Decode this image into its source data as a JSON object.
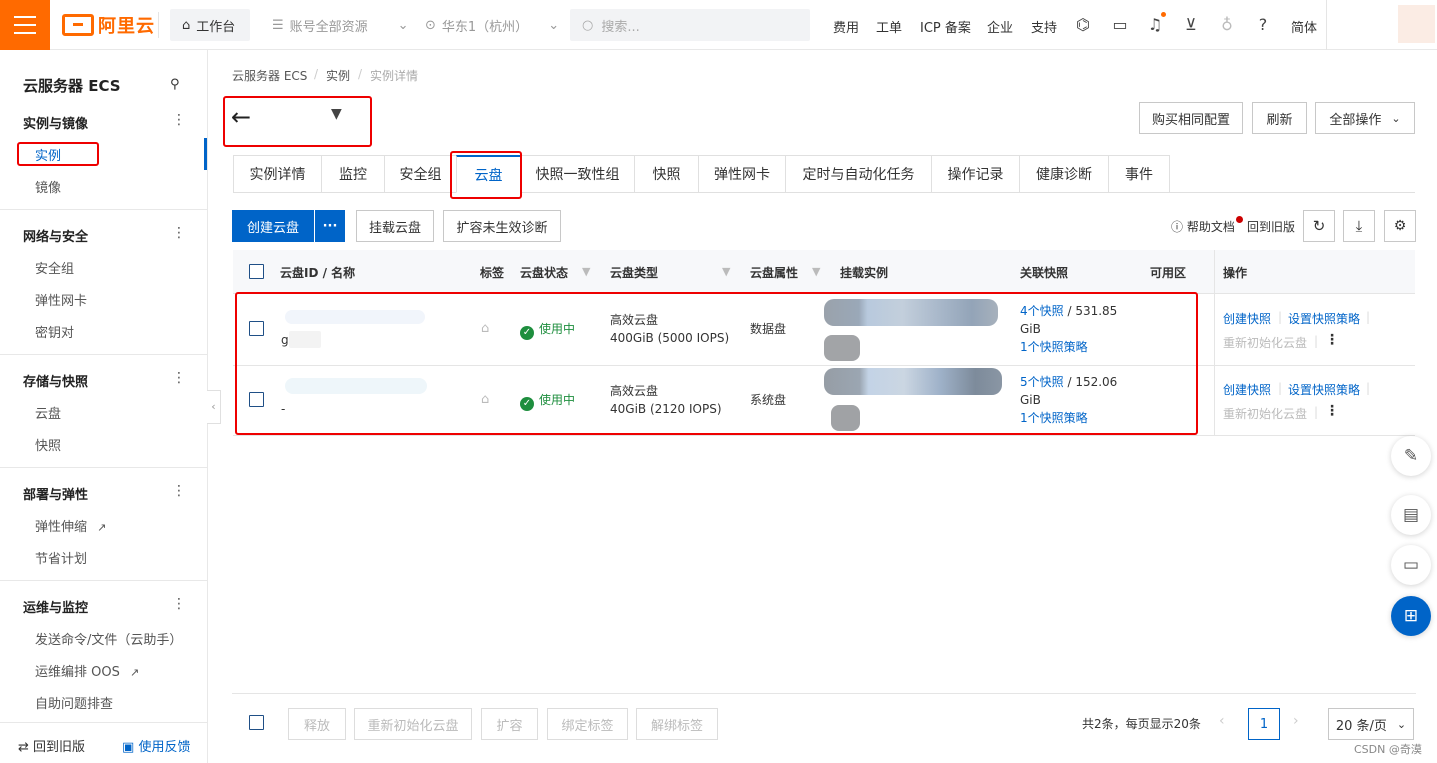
{
  "topbar": {
    "logo_text": "阿里云",
    "workbench": "工作台",
    "account_scope": "账号全部资源",
    "region": "华东1（杭州）",
    "search_placeholder": "搜索...",
    "links": [
      "费用",
      "工单",
      "ICP 备案",
      "企业",
      "支持"
    ],
    "language": "简体",
    "brand_color": "#ff6a00"
  },
  "sidebar": {
    "title": "云服务器 ECS",
    "groups": [
      {
        "title": "实例与镜像",
        "items": [
          "实例",
          "镜像"
        ]
      },
      {
        "title": "网络与安全",
        "items": [
          "安全组",
          "弹性网卡",
          "密钥对"
        ]
      },
      {
        "title": "存储与快照",
        "items": [
          "云盘",
          "快照"
        ]
      },
      {
        "title": "部署与弹性",
        "items": [
          "弹性伸缩",
          "节省计划"
        ]
      },
      {
        "title": "运维与监控",
        "items": [
          "发送命令/文件（云助手）",
          "运维编排 OOS",
          "自助问题排查"
        ]
      }
    ],
    "back_old": "回到旧版",
    "feedback": "使用反馈"
  },
  "breadcrumb": [
    "云服务器 ECS",
    "实例",
    "实例详情"
  ],
  "header_buttons": {
    "buy_same": "购买相同配置",
    "refresh": "刷新",
    "all_ops": "全部操作"
  },
  "tabs": [
    "实例详情",
    "监控",
    "安全组",
    "云盘",
    "快照一致性组",
    "快照",
    "弹性网卡",
    "定时与自动化任务",
    "操作记录",
    "健康诊断",
    "事件"
  ],
  "toolbar": {
    "create_disk": "创建云盘",
    "more": "···",
    "attach_disk": "挂载云盘",
    "diagnose": "扩容未生效诊断",
    "help_doc": "帮助文档",
    "back_old": "回到旧版"
  },
  "table": {
    "columns": [
      "云盘ID / 名称",
      "标签",
      "云盘状态",
      "云盘类型",
      "云盘属性",
      "挂载实例",
      "关联快照",
      "可用区",
      "操作"
    ],
    "rows": [
      {
        "name": "g",
        "status": "使用中",
        "type_line1": "高效云盘",
        "type_line2": "400GiB (5000 IOPS)",
        "attribute": "数据盘",
        "snapshot_count": "4个快照",
        "snapshot_size": " / 531.85",
        "snapshot_unit": "GiB",
        "snapshot_policy": "1个快照策略",
        "op_create": "创建快照",
        "op_policy": "设置快照策略",
        "op_reinit": "重新初始化云盘"
      },
      {
        "name": "-",
        "status": "使用中",
        "type_line1": "高效云盘",
        "type_line2": "40GiB (2120 IOPS)",
        "attribute": "系统盘",
        "snapshot_count": "5个快照",
        "snapshot_size": " / 152.06",
        "snapshot_unit": "GiB",
        "snapshot_policy": "1个快照策略",
        "op_create": "创建快照",
        "op_policy": "设置快照策略",
        "op_reinit": "重新初始化云盘"
      }
    ]
  },
  "footer": {
    "release": "释放",
    "reinit": "重新初始化云盘",
    "expand": "扩容",
    "bind_tag": "绑定标签",
    "unbind_tag": "解绑标签",
    "total": "共2条，每页显示20条",
    "page": "1",
    "page_size": "20 条/页"
  },
  "watermark": "CSDN @奇漠"
}
